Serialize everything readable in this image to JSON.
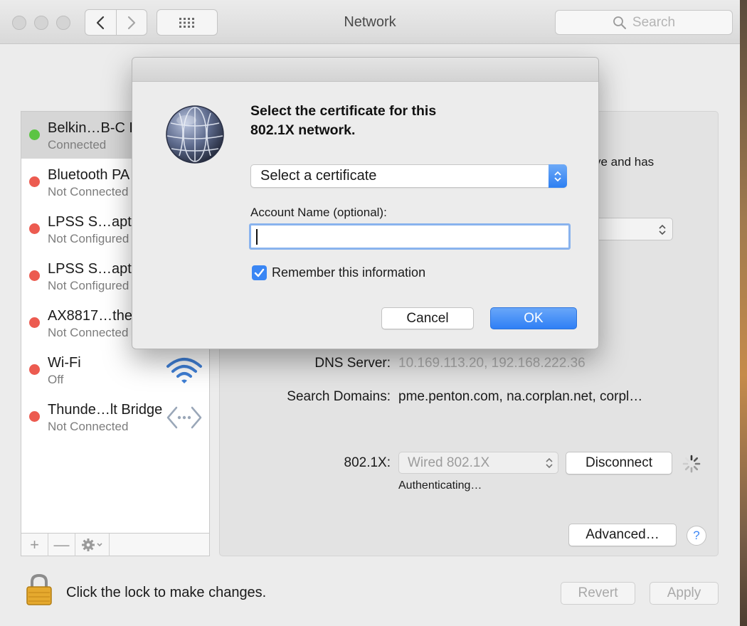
{
  "window": {
    "title": "Network",
    "search_placeholder": "Search"
  },
  "toolbar": {
    "back_icon": "chevron-left-icon",
    "forward_icon": "chevron-right-icon",
    "grid_icon": "show-all-grid-icon"
  },
  "services": [
    {
      "name": "Belkin…B-C L",
      "status": "Connected",
      "color": "#5cc443",
      "selected": true
    },
    {
      "name": "Bluetooth PA",
      "status": "Not Connected",
      "color": "#ec5b50"
    },
    {
      "name": "LPSS S…apte",
      "status": "Not Configured",
      "color": "#ec5b50"
    },
    {
      "name": "LPSS S…apte",
      "status": "Not Configured",
      "color": "#ec5b50"
    },
    {
      "name": "AX8817…the",
      "status": "Not Connected",
      "color": "#ec5b50"
    },
    {
      "name": "Wi-Fi",
      "status": "Off",
      "color": "#ec5b50",
      "icon": "wifi-icon"
    },
    {
      "name": "Thunde…lt Bridge",
      "status": "Not Connected",
      "color": "#ec5b50",
      "icon": "thunderbolt-bridge-icon"
    }
  ],
  "sidebar_footer": {
    "add": "+",
    "remove": "—",
    "action_icon": "gear-icon"
  },
  "detail": {
    "partial_text": "ve and has",
    "dns_label": "DNS Server:",
    "dns_value": "10.169.113.20, 192.168.222.36",
    "search_domains_label": "Search Domains:",
    "search_domains_value": "pme.penton.com, na.corplan.net, corpl…",
    "dot1x_label": "802.1X:",
    "dot1x_value": "Wired 802.1X",
    "disconnect": "Disconnect",
    "authenticating": "Authenticating…",
    "advanced": "Advanced…",
    "help": "?"
  },
  "footer": {
    "lock_text": "Click the lock to make changes.",
    "revert": "Revert",
    "apply": "Apply"
  },
  "dialog": {
    "title_line1": "Select the certificate for this",
    "title_line2": "802.1X network.",
    "certificate_popup": "Select a certificate",
    "account_label": "Account Name (optional):",
    "account_value": "",
    "remember_label": "Remember this information",
    "remember_checked": true,
    "cancel": "Cancel",
    "ok": "OK"
  },
  "colors": {
    "accent": "#3a86f4",
    "connected": "#5cc443",
    "disconnected": "#ec5b50"
  }
}
